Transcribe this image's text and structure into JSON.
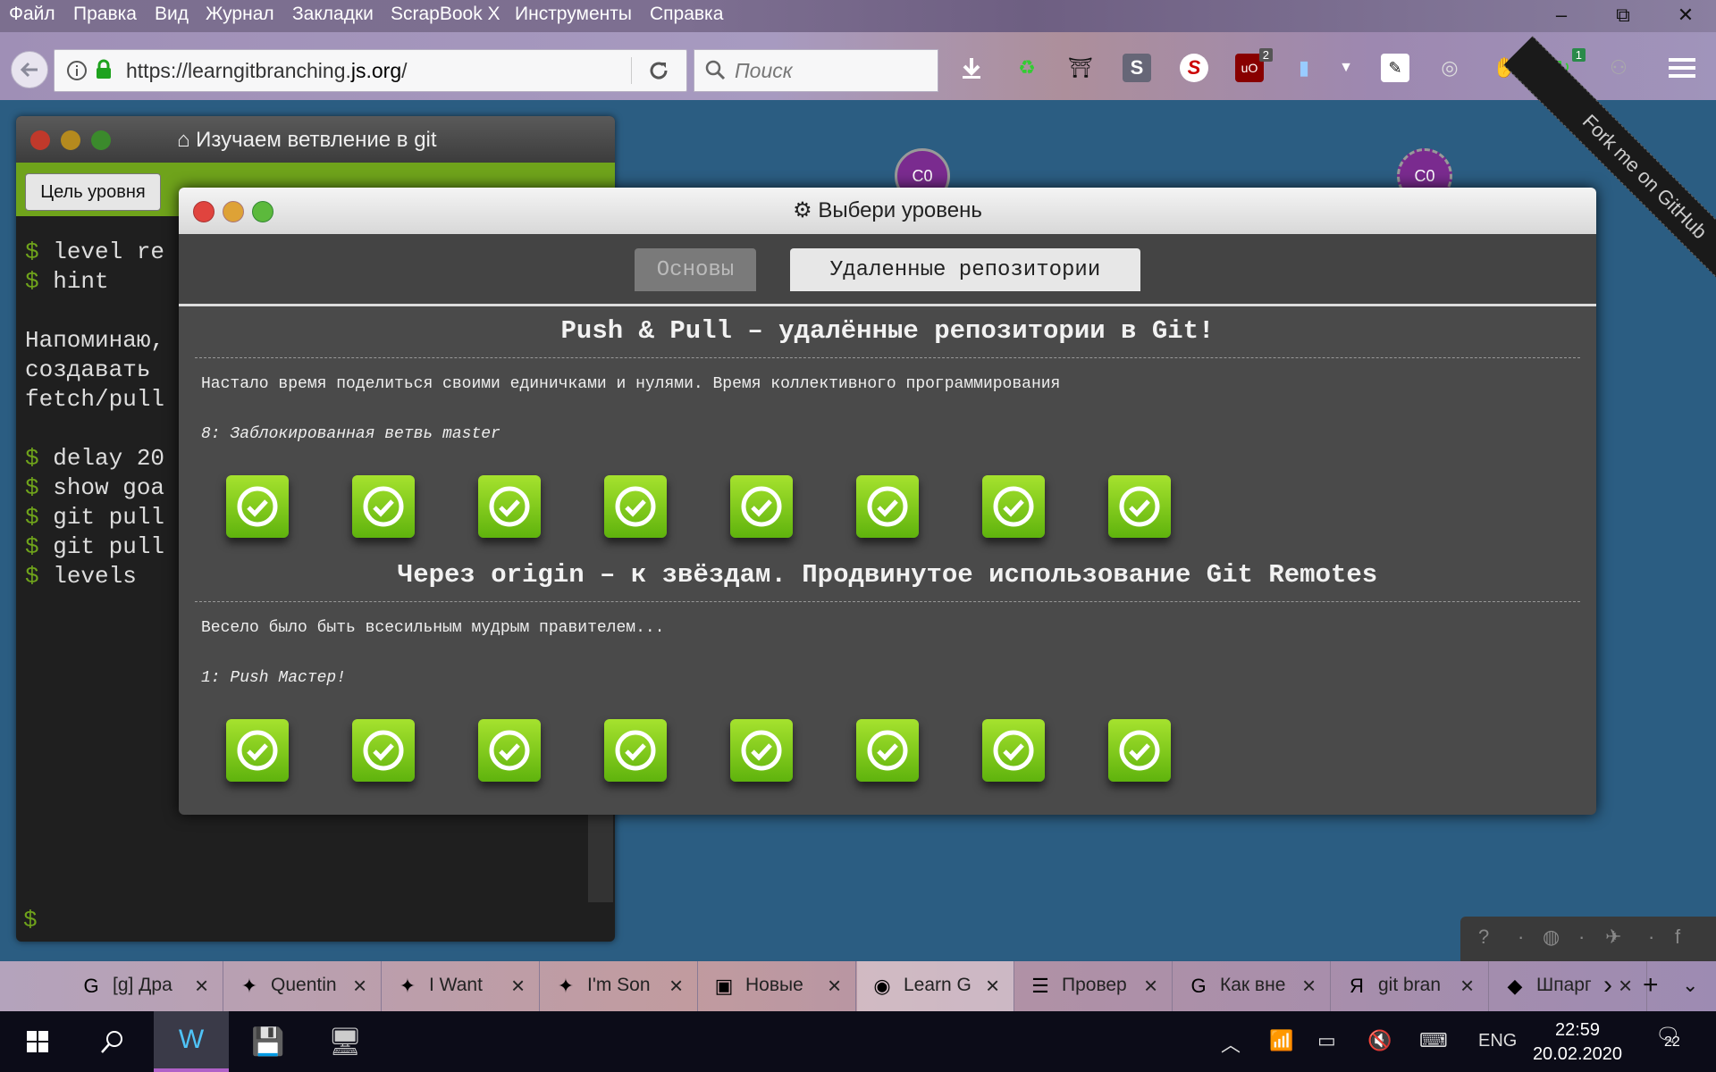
{
  "menu": {
    "items": [
      "Файл",
      "Правка",
      "Вид",
      "Журнал",
      "Закладки",
      "ScrapBook X",
      "Инструменты",
      "Справка"
    ],
    "minimize": "–",
    "restore": "⧉",
    "close": "✕"
  },
  "nav": {
    "url_prefix": "https://learngitbranching.",
    "url_domain": "js.org",
    "url_suffix": "/",
    "search_placeholder": "Поиск",
    "ext_badges": {
      "ublock": "2",
      "sync": "1"
    }
  },
  "page": {
    "ribbon": "Fork me on GitHub",
    "nodes": [
      "C0",
      "C0"
    ]
  },
  "terminal": {
    "title": "Изучаем ветвление в git",
    "goal_button": "Цель уровня",
    "lines": [
      {
        "prompt": "$",
        "text": " level re"
      },
      {
        "prompt": "$",
        "text": " hint"
      },
      {
        "prompt": "",
        "text": ""
      },
      {
        "prompt": "",
        "text": "Напоминаю,"
      },
      {
        "prompt": "",
        "text": "создавать"
      },
      {
        "prompt": "",
        "text": "fetch/pull"
      },
      {
        "prompt": "",
        "text": ""
      },
      {
        "prompt": "$",
        "text": " delay 20"
      },
      {
        "prompt": "$",
        "text": " show goa"
      },
      {
        "prompt": "$",
        "text": " git pull"
      },
      {
        "prompt": "$",
        "text": " git pull"
      },
      {
        "prompt": "$",
        "text": " levels"
      }
    ],
    "bottom_prompt": "$"
  },
  "dialog": {
    "title": "Выбери уровень",
    "tabs": [
      "Основы",
      "Удаленные репозитории"
    ],
    "active_tab": 1,
    "sections": [
      {
        "title": "Push & Pull – удалённые репозитории в Git!",
        "desc": "Настало время поделиться своими единичками и нулями. Время коллективного программирования",
        "sub": "8: Заблокированная ветвь master",
        "levels": 8
      },
      {
        "title": "Через origin – к звёздам. Продвинутое использование Git Remotes",
        "desc": "Весело было быть всесильным мудрым правителем...",
        "sub": "1: Push Мастер!",
        "levels": 8
      }
    ]
  },
  "tabs": [
    {
      "icon": "G",
      "label": "[g] Дра"
    },
    {
      "icon": "✦",
      "label": "Quentin"
    },
    {
      "icon": "✦",
      "label": "I Want"
    },
    {
      "icon": "✦",
      "label": "I'm Son"
    },
    {
      "icon": "▣",
      "label": "Новые"
    },
    {
      "icon": "◉",
      "label": "Learn G"
    },
    {
      "icon": "☰",
      "label": "Провер"
    },
    {
      "icon": "G",
      "label": "Как вне"
    },
    {
      "icon": "Я",
      "label": "git bran"
    },
    {
      "icon": "◆",
      "label": "Шпарг"
    }
  ],
  "taskbar": {
    "lang": "ENG",
    "time": "22:59",
    "date": "20.02.2020",
    "notifications": "22"
  },
  "colors": {
    "page_bg": "#2b5d82",
    "terminal_green": "#6fa31b",
    "level_done": "#7fcc1c",
    "node": "#7a2b8f"
  }
}
